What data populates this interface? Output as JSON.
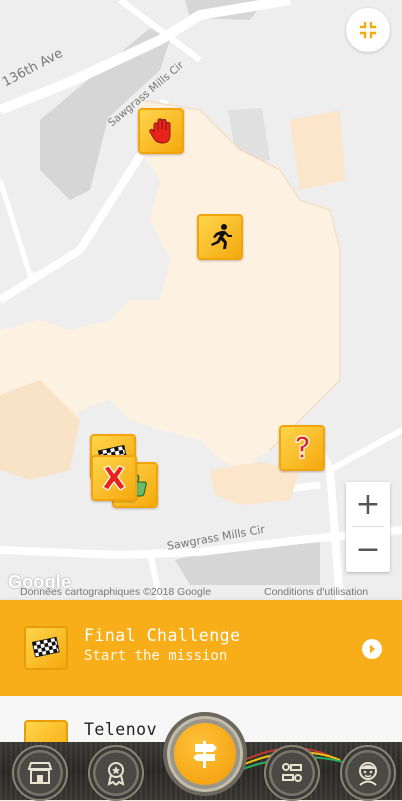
{
  "map": {
    "roads": {
      "road_1": "136th Ave",
      "road_2": "Sawgrass Mills Cir",
      "road_3": "Sawgrass Mills Cir"
    },
    "google_logo": "Google",
    "attribution": {
      "map_data": "Données cartographiques ©2018 Google",
      "terms": "Conditions d'utilisation"
    },
    "zoom_in": "+",
    "zoom_out": "−",
    "markers": [
      "hand-stop-marker",
      "runner-marker",
      "question-mark-marker",
      "checkered-flag-marker",
      "x-marker",
      "thumbs-up-marker"
    ]
  },
  "mission_banner": {
    "title": "Final Challenge",
    "subtitle": "Start the mission"
  },
  "list": {
    "item_title": "Telenov"
  },
  "colors": {
    "accent": "#f8ae18",
    "marker_yellow": "#ffd54a",
    "building": "#fdf1e1"
  },
  "bottom_nav": [
    "shop-icon",
    "badge-icon",
    "signpost-icon",
    "controls-icon",
    "avatar-icon"
  ]
}
